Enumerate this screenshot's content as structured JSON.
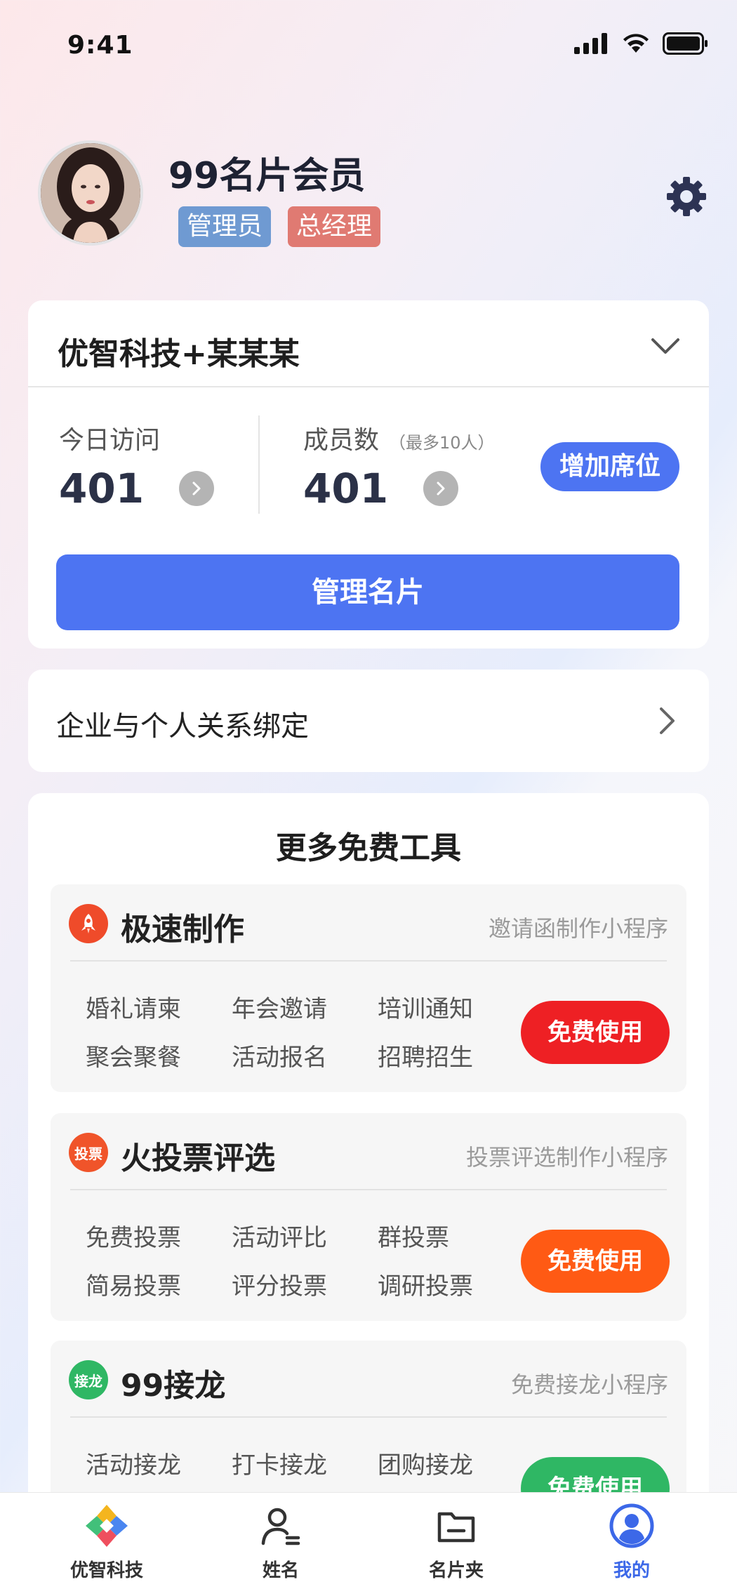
{
  "status_bar": {
    "time": "9:41"
  },
  "profile": {
    "name": "99名片会员",
    "badges": [
      "管理员",
      "总经理"
    ]
  },
  "company": {
    "name": "优智科技+某某某",
    "visits_label": "今日访问",
    "visits_value": "401",
    "members_label": "成员数",
    "members_sub": "（最多10人）",
    "members_value": "401",
    "add_seat": "增加席位",
    "manage_button": "管理名片"
  },
  "binding": {
    "label": "企业与个人关系绑定"
  },
  "tools": {
    "title": "更多免费工具",
    "items": [
      {
        "icon_text": "",
        "name": "极速制作",
        "desc": "邀请函制作小程序",
        "tags": [
          "婚礼请柬",
          "年会邀请",
          "培训通知",
          "聚会聚餐",
          "活动报名",
          "招聘招生"
        ],
        "button": "免费使用",
        "color": "#ee2024"
      },
      {
        "icon_text": "投票",
        "name": "火投票评选",
        "desc": "投票评选制作小程序",
        "tags": [
          "免费投票",
          "活动评比",
          "群投票",
          "简易投票",
          "评分投票",
          "调研投票"
        ],
        "button": "免费使用",
        "color": "#ff5a14"
      },
      {
        "icon_text": "接龙",
        "name": "99接龙",
        "desc": "免费接龙小程序",
        "tags": [
          "活动接龙",
          "打卡接龙",
          "团购接龙"
        ],
        "button": "免费使用",
        "color": "#2fb764"
      }
    ]
  },
  "tabbar": {
    "items": [
      {
        "label": "优智科技",
        "icon": "brand-logo-icon"
      },
      {
        "label": "姓名",
        "icon": "person-icon"
      },
      {
        "label": "名片夹",
        "icon": "folder-icon"
      },
      {
        "label": "我的",
        "icon": "profile-icon",
        "active": true
      }
    ]
  }
}
